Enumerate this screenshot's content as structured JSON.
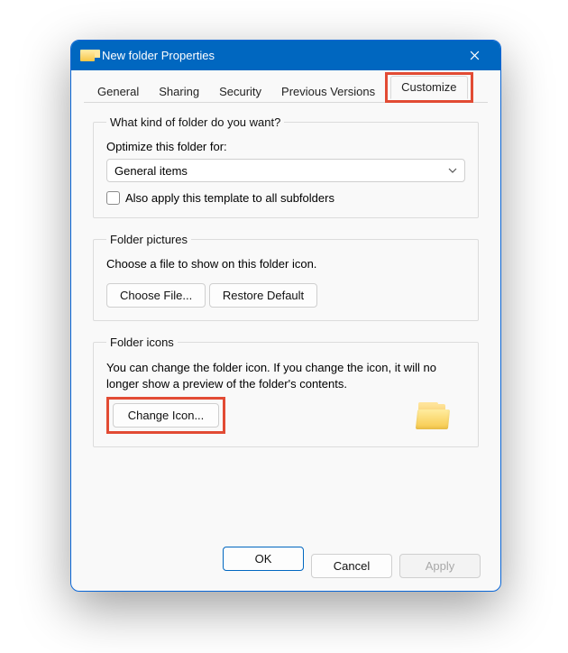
{
  "window": {
    "title": "New folder Properties"
  },
  "tabs": {
    "general": "General",
    "sharing": "Sharing",
    "security": "Security",
    "previous": "Previous Versions",
    "customize": "Customize"
  },
  "group1": {
    "legend": "What kind of folder do you want?",
    "optimize_label": "Optimize this folder for:",
    "selected": "General items",
    "checkbox_label": "Also apply this template to all subfolders"
  },
  "group2": {
    "legend": "Folder pictures",
    "desc": "Choose a file to show on this folder icon.",
    "choose_file": "Choose File...",
    "restore_default": "Restore Default"
  },
  "group3": {
    "legend": "Folder icons",
    "desc": "You can change the folder icon. If you change the icon, it will no longer show a preview of the folder's contents.",
    "change_icon": "Change Icon..."
  },
  "footer": {
    "ok": "OK",
    "cancel": "Cancel",
    "apply": "Apply"
  }
}
